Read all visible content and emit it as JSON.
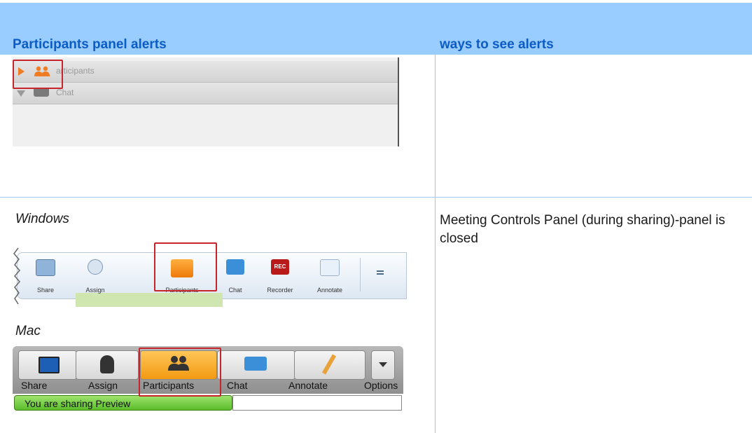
{
  "table": {
    "headers": [
      "Participants panel alerts",
      "ways to see alerts"
    ],
    "rows": [
      {
        "captions": [
          "Windows",
          "Mac"
        ],
        "description": "Meeting Controls Panel (during sharing)-panel is closed"
      }
    ]
  },
  "panel_screenshot": {
    "items": [
      "articipants",
      "Chat"
    ]
  },
  "windows_toolbar": {
    "buttons": [
      "Share",
      "Assign",
      "Participants",
      "Chat",
      "Recorder",
      "Annotate"
    ]
  },
  "mac_toolbar": {
    "buttons": [
      "Share",
      "Assign",
      "Participants",
      "Chat",
      "Annotate",
      "Options"
    ],
    "status": "You are sharing Preview"
  },
  "colors": {
    "header_bg": "#99ccff",
    "header_text": "#0b5cc4",
    "highlight": "#c8242b",
    "accent_orange": "#f29a12"
  }
}
